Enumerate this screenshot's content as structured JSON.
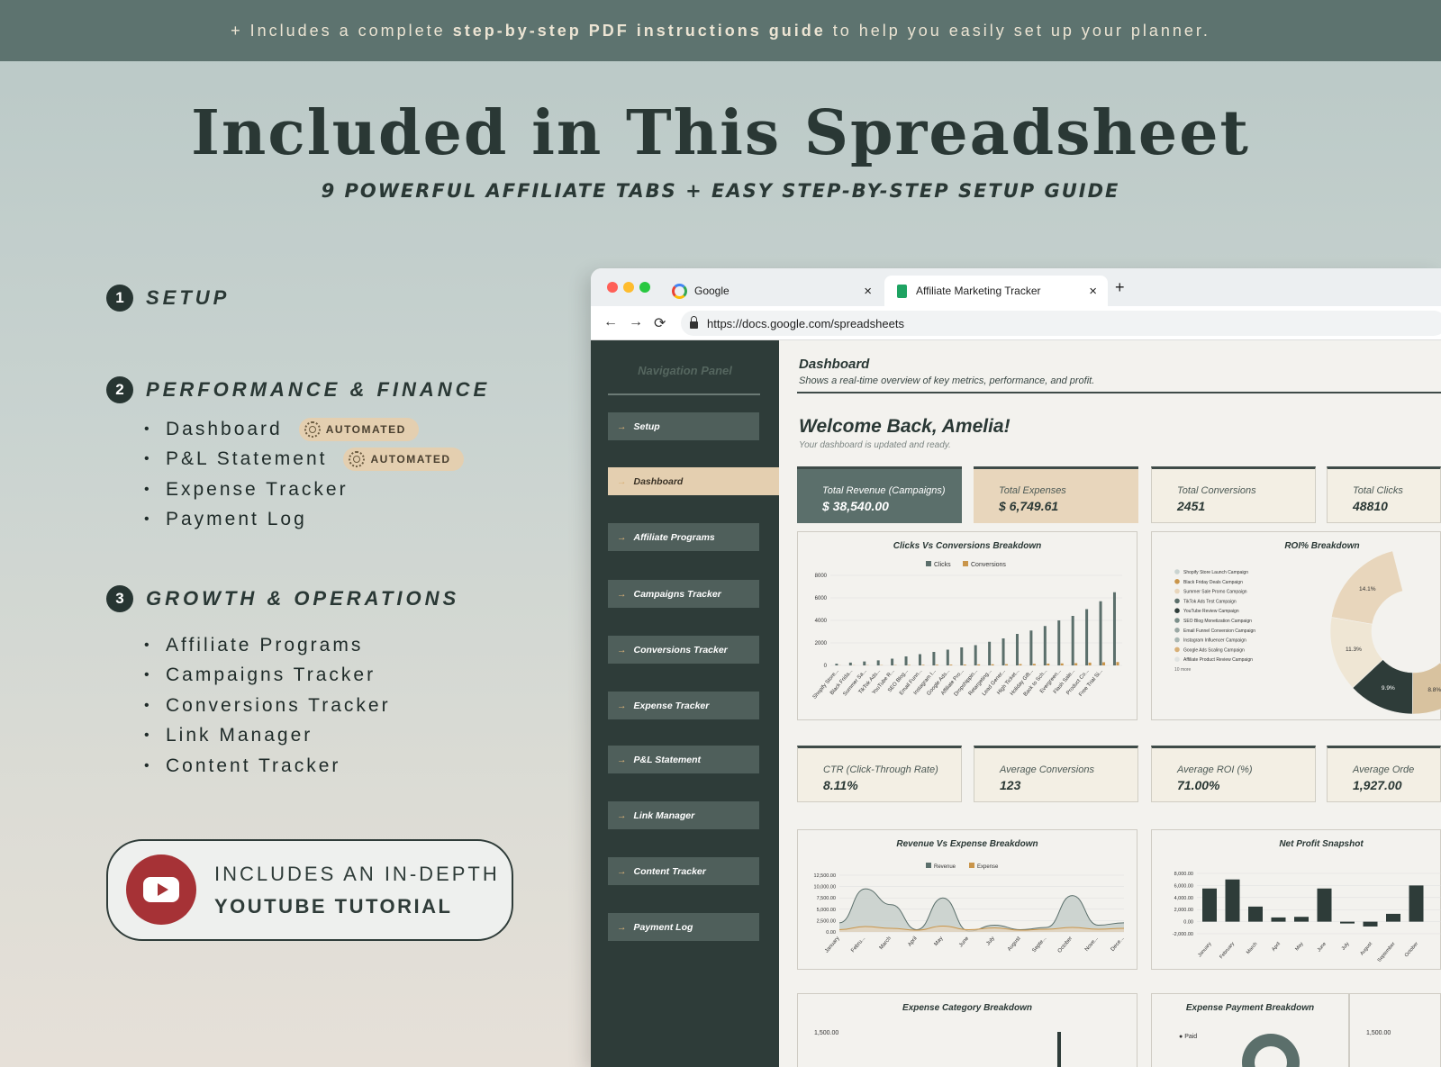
{
  "banner": {
    "prefix": "+ Includes a complete ",
    "bold": "step-by-step PDF instructions guide",
    "suffix": " to help you easily set up your planner."
  },
  "hero": {
    "title": "Included in This Spreadsheet",
    "subtitle": "9 POWERFUL AFFILIATE TABS + EASY STEP-BY-STEP SETUP GUIDE"
  },
  "sections": [
    {
      "num": "1",
      "title": "SETUP",
      "items": []
    },
    {
      "num": "2",
      "title": "PERFORMANCE & FINANCE",
      "items": [
        {
          "label": "Dashboard",
          "badge": "AUTOMATED"
        },
        {
          "label": "P&L Statement",
          "badge": "AUTOMATED"
        },
        {
          "label": "Expense Tracker"
        },
        {
          "label": "Payment Log"
        }
      ]
    },
    {
      "num": "3",
      "title": "GROWTH & OPERATIONS",
      "items": [
        {
          "label": "Affiliate Programs"
        },
        {
          "label": "Campaigns Tracker"
        },
        {
          "label": "Conversions Tracker"
        },
        {
          "label": "Link Manager"
        },
        {
          "label": "Content Tracker"
        }
      ]
    }
  ],
  "youtube": {
    "line1": "INCLUDES AN IN-DEPTH",
    "line2": "YOUTUBE TUTORIAL"
  },
  "browser": {
    "tabs": [
      {
        "label": "Google"
      },
      {
        "label": "Affiliate Marketing Tracker"
      }
    ],
    "new_tab": "+",
    "close": "×",
    "url": "https://docs.google.com/spreadsheets",
    "nav": {
      "back": "←",
      "forward": "→",
      "reload": "⟳"
    }
  },
  "sidebar": {
    "title": "Navigation Panel",
    "arrow": "→",
    "items": [
      {
        "label": "Setup"
      },
      {
        "label": "Dashboard",
        "active": true
      },
      {
        "label": "Affiliate Programs"
      },
      {
        "label": "Campaigns Tracker"
      },
      {
        "label": "Conversions Tracker"
      },
      {
        "label": "Expense Tracker"
      },
      {
        "label": "P&L Statement"
      },
      {
        "label": "Link Manager"
      },
      {
        "label": "Content Tracker"
      },
      {
        "label": "Payment Log"
      }
    ]
  },
  "dashboard": {
    "title": "Dashboard",
    "description": "Shows a real-time overview of key metrics, performance, and profit.",
    "welcome": "Welcome Back, Amelia!",
    "welcome_sub": "Your dashboard is updated and ready.",
    "kpis_row1": [
      {
        "label": "Total Revenue (Campaigns)",
        "value": "$ 38,540.00"
      },
      {
        "label": "Total Expenses",
        "value": "$ 6,749.61"
      },
      {
        "label": "Total Conversions",
        "value": "2451"
      },
      {
        "label": "Total Clicks",
        "value": "48810"
      }
    ],
    "kpis_row2": [
      {
        "label": "CTR (Click-Through Rate)",
        "value": "8.11%"
      },
      {
        "label": "Average Conversions",
        "value": "123"
      },
      {
        "label": "Average ROI (%)",
        "value": "71.00%"
      },
      {
        "label": "Average Orde",
        "value": "1,927.00"
      }
    ],
    "charts": {
      "clicks_title": "Clicks Vs Conversions Breakdown",
      "roi_title": "ROI% Breakdown",
      "revexp_title": "Revenue Vs Expense Breakdown",
      "netprofit_title": "Net Profit Snapshot",
      "expcat_title": "Expense Category Breakdown",
      "exppay_title": "Expense Payment Breakdown",
      "exppay_legend": "Paid",
      "expcat_ytick": "1,500.00",
      "exppay_ytick": "1,500.00"
    }
  },
  "colors": {
    "dark_green": "#2e3c39",
    "mid_green": "#5b6f6b",
    "tan": "#e8d6bc",
    "gold": "#c9954a",
    "youtube_red": "#a63236"
  },
  "chart_data": [
    {
      "type": "bar",
      "title": "Clicks Vs Conversions Breakdown",
      "categories": [
        "Shopify Store...",
        "Black Frida...",
        "Summer Sa...",
        "TikTok Ads...",
        "YouTube R...",
        "SEO Blog...",
        "Email Funn...",
        "Instagram I...",
        "Google Ads...",
        "Affiliate Pro...",
        "Dropshippin...",
        "Retargeting...",
        "Lead Gener...",
        "High Ticket...",
        "Holiday Gift...",
        "Back to Sch...",
        "Evergreen...",
        "Flash Sale...",
        "Product Co...",
        "Free Trial Si..."
      ],
      "series": [
        {
          "name": "Clicks",
          "values": [
            150,
            250,
            350,
            450,
            600,
            800,
            1000,
            1200,
            1400,
            1600,
            1800,
            2100,
            2400,
            2800,
            3100,
            3500,
            4000,
            4400,
            5000,
            5700,
            6500
          ]
        },
        {
          "name": "Conversions",
          "values": [
            10,
            15,
            20,
            25,
            30,
            40,
            50,
            60,
            70,
            80,
            90,
            100,
            110,
            120,
            140,
            160,
            180,
            200,
            250,
            280,
            300
          ]
        }
      ],
      "yticks": [
        "8000",
        "6000",
        "4000",
        "2000",
        "0"
      ],
      "ylim": [
        0,
        8000
      ]
    },
    {
      "type": "pie",
      "title": "ROI% Breakdown",
      "legend": [
        "Shopify Store Launch Campaign",
        "Black Friday Deals Campaign",
        "Summer Sale Promo Campaign",
        "TikTok Ads Test Campaign",
        "YouTube Review Campaign",
        "SEO Blog Monetization Campaign",
        "Email Funnel Conversion Campaign",
        "Instagram Influencer Campaign",
        "Google Ads Scaling Campaign",
        "Affiliate Product Review Campaign"
      ],
      "legend_more": "10 more",
      "labels": [
        "14.1%",
        "11.3%",
        "9.9%",
        "8.8%",
        "7.7%",
        "6.7"
      ],
      "values": [
        14.1,
        11.3,
        9.9,
        8.8,
        7.7,
        6.7
      ]
    },
    {
      "type": "area",
      "title": "Revenue Vs Expense Breakdown",
      "categories": [
        "January",
        "Febru...",
        "March",
        "April",
        "May",
        "June",
        "July",
        "August",
        "Septe...",
        "October",
        "Nove...",
        "Dece..."
      ],
      "series": [
        {
          "name": "Revenue",
          "values": [
            2000,
            9500,
            6000,
            500,
            7500,
            200,
            1500,
            500,
            1000,
            8000,
            1500,
            2000
          ]
        },
        {
          "name": "Expense",
          "values": [
            500,
            1200,
            800,
            400,
            1300,
            500,
            900,
            400,
            600,
            1000,
            600,
            800
          ]
        }
      ],
      "yticks": [
        "12,500.00",
        "10,000.00",
        "7,500.00",
        "5,000.00",
        "2,500.00",
        "0.00"
      ],
      "ylim": [
        0,
        12500
      ]
    },
    {
      "type": "bar",
      "title": "Net Profit Snapshot",
      "categories": [
        "January",
        "February",
        "March",
        "April",
        "May",
        "June",
        "July",
        "August",
        "September",
        "October"
      ],
      "values": [
        5500,
        7000,
        2500,
        700,
        800,
        5500,
        -300,
        -800,
        1300,
        6000
      ],
      "yticks": [
        "8,000.00",
        "6,000.00",
        "4,000.00",
        "2,000.00",
        "0.00",
        "-2,000.00"
      ],
      "ylim": [
        -2000,
        8000
      ]
    }
  ]
}
